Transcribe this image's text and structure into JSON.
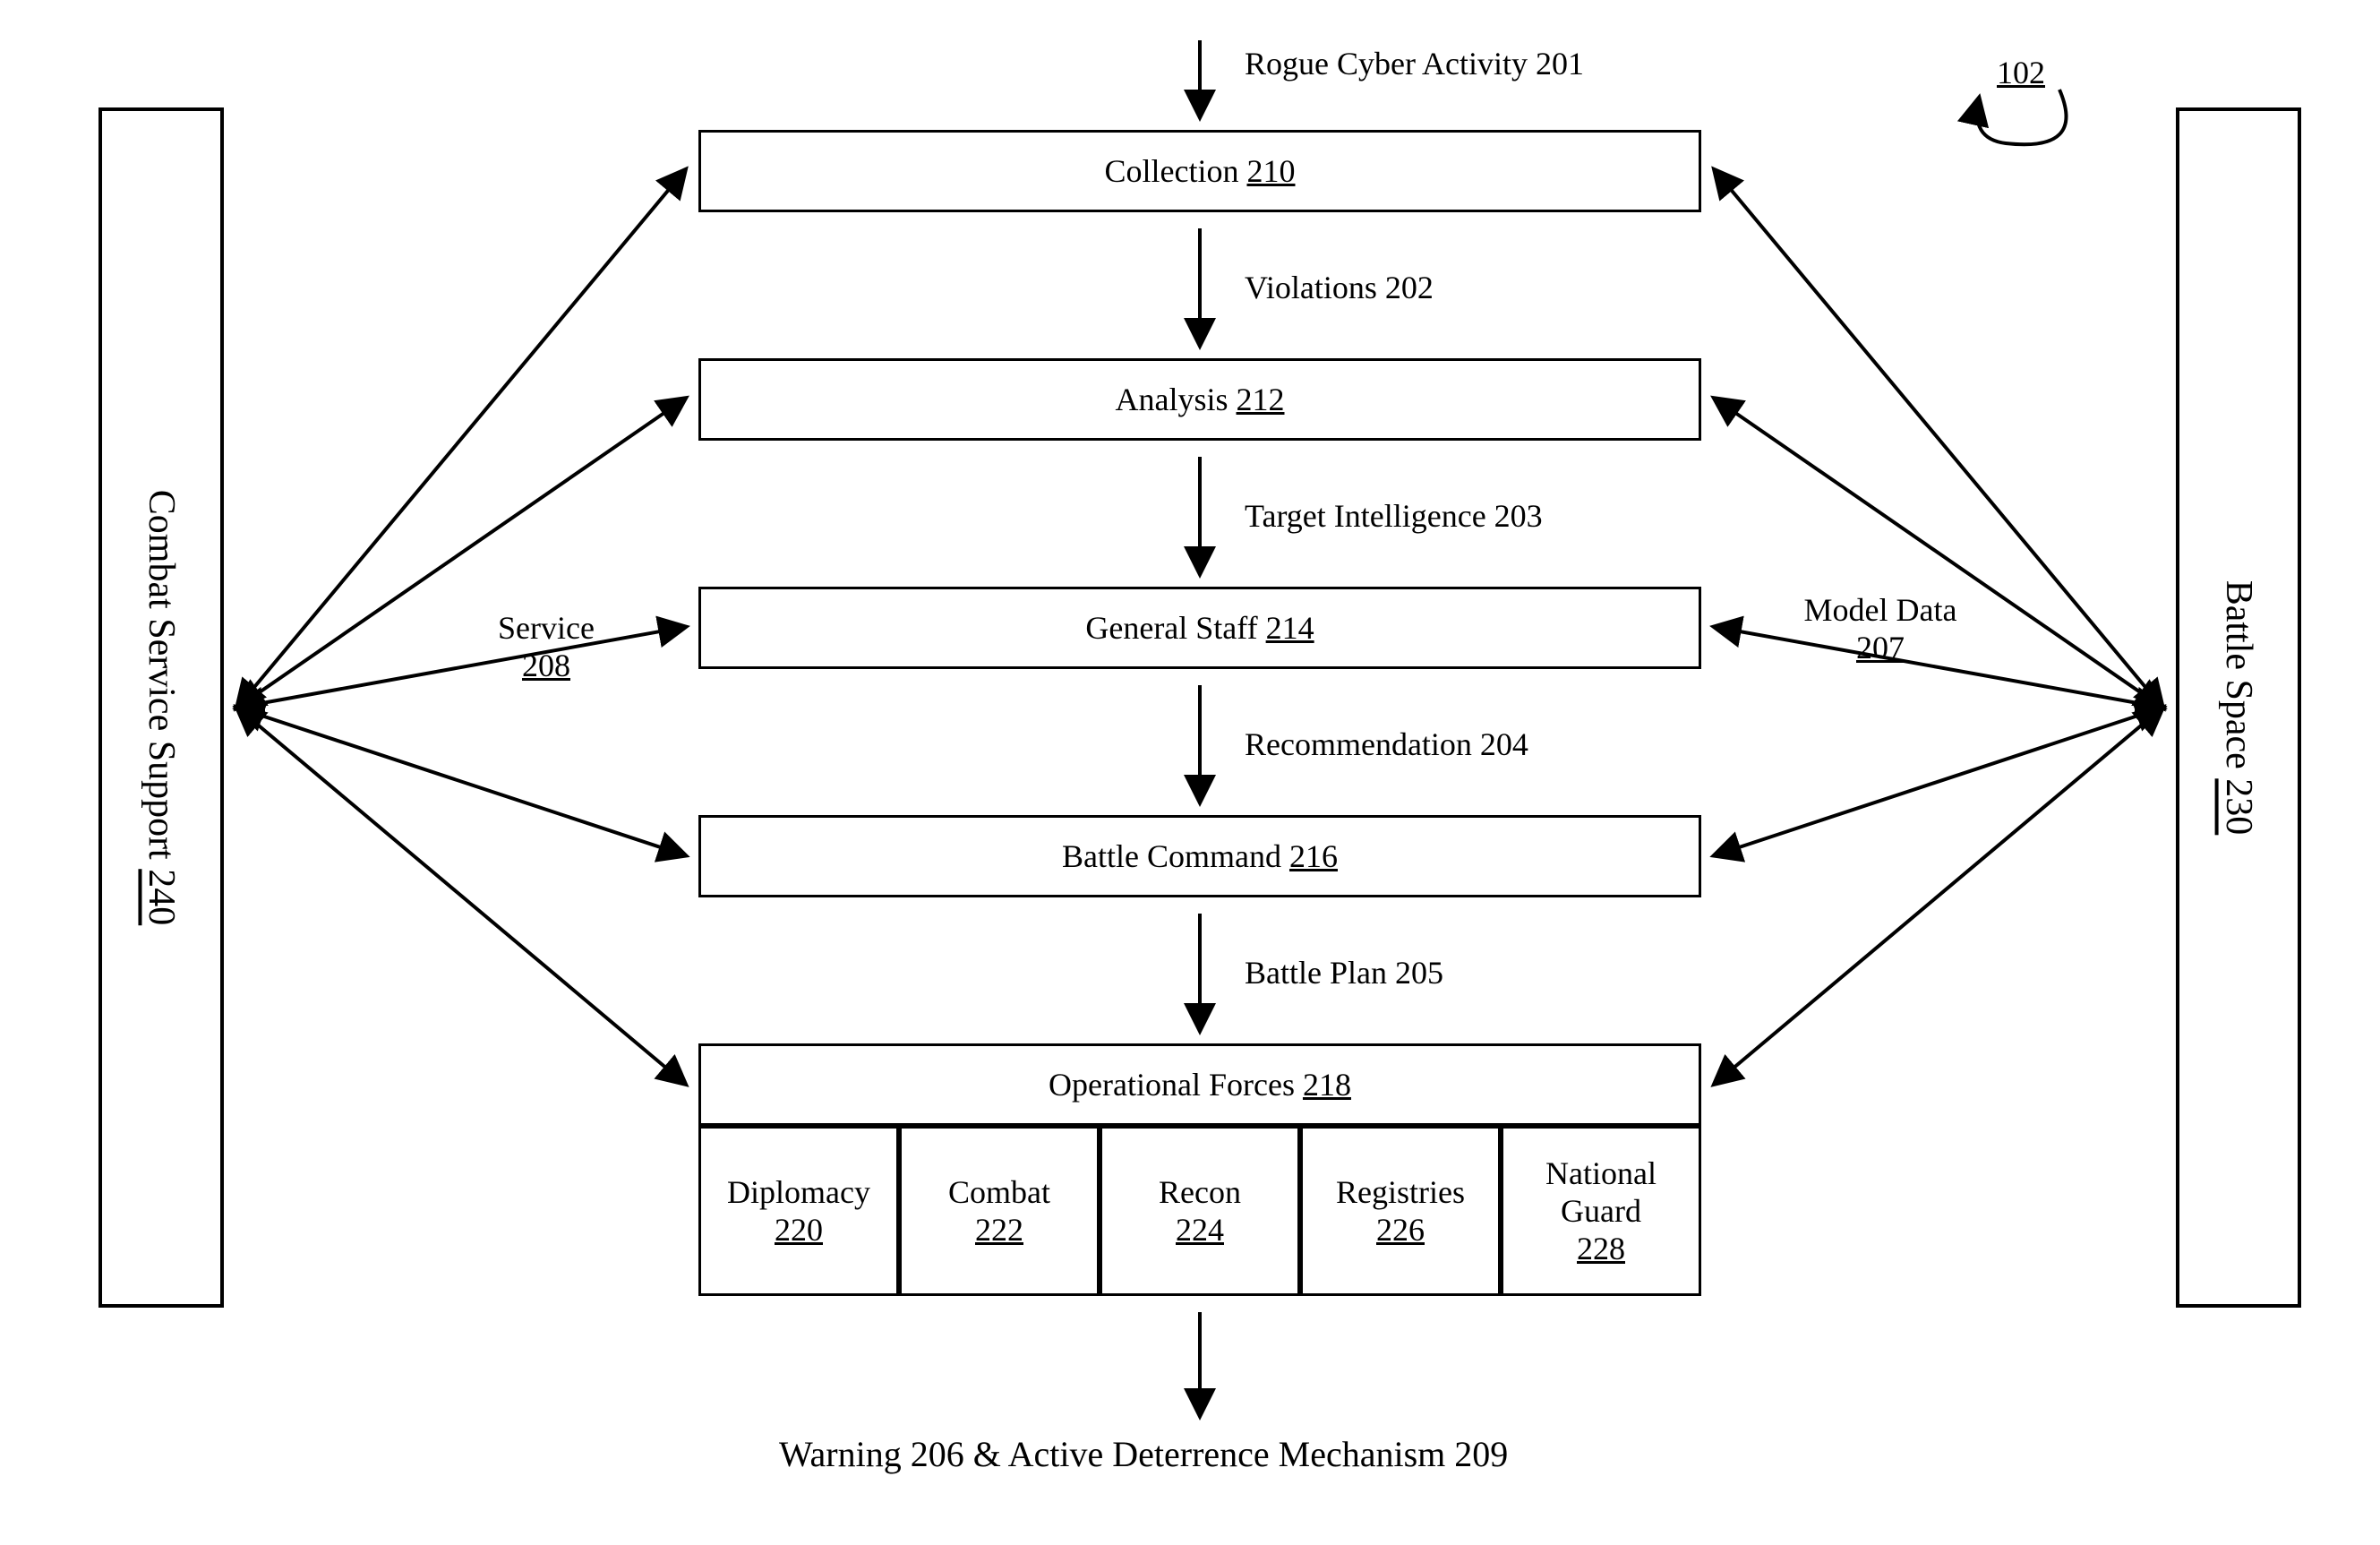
{
  "figure_ref": "102",
  "flows": {
    "top_in": "Rogue Cyber Activity 201",
    "f1": "Violations 202",
    "f2": "Target Intelligence 203",
    "f3": "Recommendation 204",
    "f4": "Battle Plan 205",
    "bottom": "Warning 206 & Active Deterrence Mechanism 209"
  },
  "center_blocks": {
    "collection": {
      "name": "Collection",
      "ref": "210"
    },
    "analysis": {
      "name": "Analysis",
      "ref": "212"
    },
    "general_staff": {
      "name": "General Staff",
      "ref": "214"
    },
    "battle_command": {
      "name": "Battle Command",
      "ref": "216"
    },
    "op_forces": {
      "name": "Operational Forces",
      "ref": "218"
    }
  },
  "forces": {
    "diplomacy": {
      "name": "Diplomacy",
      "ref": "220"
    },
    "combat": {
      "name": "Combat",
      "ref": "222"
    },
    "recon": {
      "name": "Recon",
      "ref": "224"
    },
    "reg": {
      "name": "Registries",
      "ref": "226"
    },
    "natguard": {
      "name": "National Guard",
      "ref": "228"
    }
  },
  "left_side": {
    "name": "Combat Service Support",
    "ref": "240"
  },
  "right_side": {
    "name": "Battle Space",
    "ref": "230"
  },
  "side_labels": {
    "service": {
      "name": "Service",
      "ref": "208"
    },
    "model_data": {
      "name": "Model Data",
      "ref": "207"
    }
  }
}
